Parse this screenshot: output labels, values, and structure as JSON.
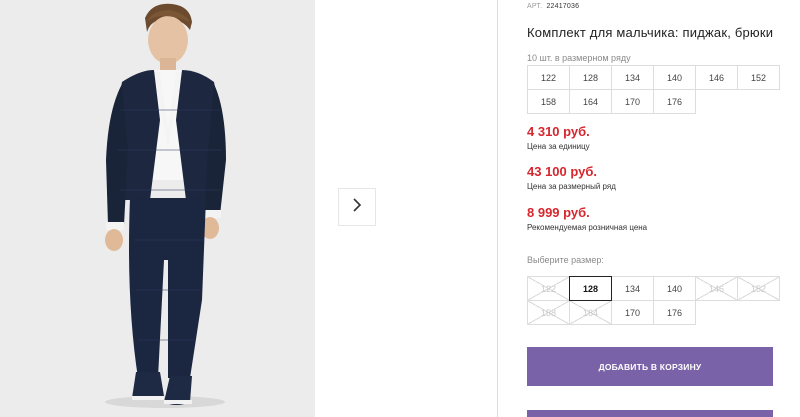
{
  "gallery": {
    "next_icon": "chevron-right-icon"
  },
  "product": {
    "article_label": "АРТ.",
    "article_value": "22417036",
    "title": "Комплект для мальчика: пиджак, брюки",
    "pack_note": "10 шт. в размерном ряду",
    "pack_sizes": [
      "122",
      "128",
      "134",
      "140",
      "146",
      "152",
      "158",
      "164",
      "170",
      "176"
    ]
  },
  "prices": {
    "unit_price": "4 310 руб.",
    "unit_label": "Цена за единицу",
    "row_price": "43 100 руб.",
    "row_label": "Цена за размерный ряд",
    "retail_price": "8 999 руб.",
    "retail_label": "Рекомендуемая розничная цена"
  },
  "size_select": {
    "label": "Выберите размер:",
    "sizes": [
      {
        "label": "122",
        "state": "unavailable"
      },
      {
        "label": "128",
        "state": "selected"
      },
      {
        "label": "134",
        "state": "available"
      },
      {
        "label": "140",
        "state": "available"
      },
      {
        "label": "146",
        "state": "unavailable"
      },
      {
        "label": "152",
        "state": "unavailable"
      },
      {
        "label": "158",
        "state": "unavailable"
      },
      {
        "label": "164",
        "state": "unavailable"
      },
      {
        "label": "170",
        "state": "available"
      },
      {
        "label": "176",
        "state": "available"
      }
    ]
  },
  "actions": {
    "add_to_cart": "ДОБАВИТЬ В КОРЗИНУ"
  },
  "colors": {
    "price_red": "#d6262e",
    "button_purple": "#7a62a8",
    "suit_navy": "#1d2840"
  }
}
